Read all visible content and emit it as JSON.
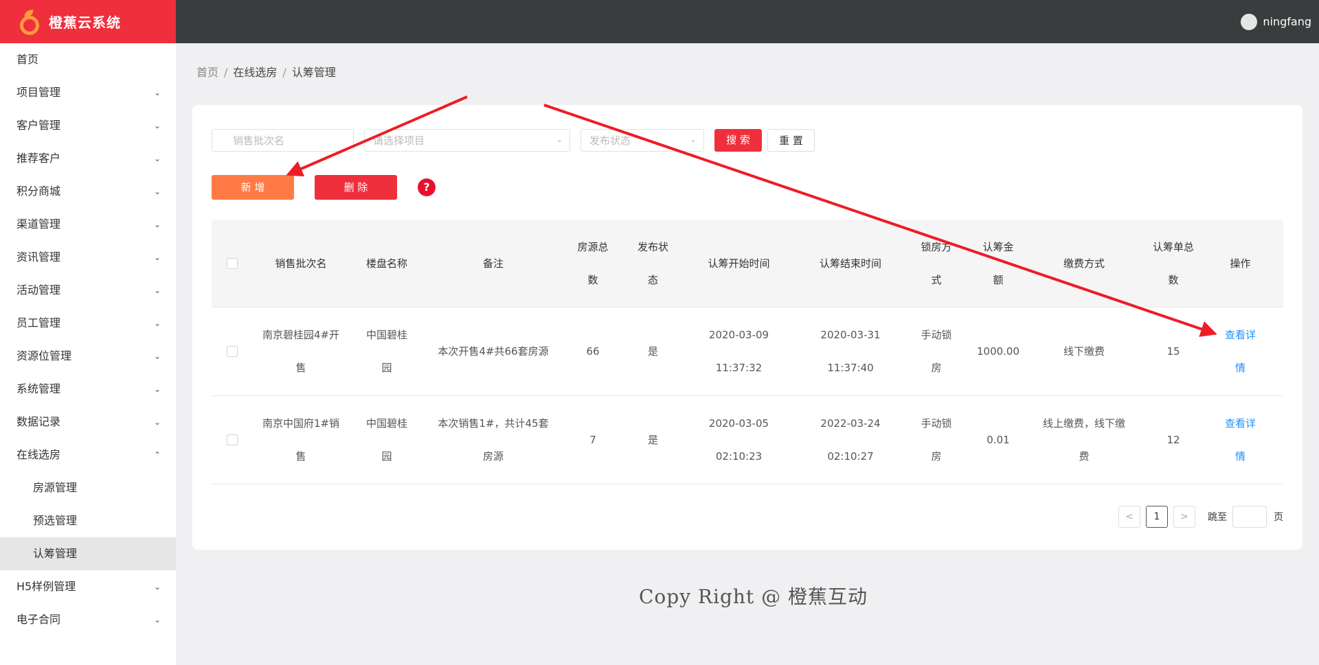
{
  "header": {
    "app_name": "橙蕉云系统",
    "username": "ningfang"
  },
  "sidebar": {
    "items": [
      {
        "label": "首页"
      },
      {
        "label": "项目管理"
      },
      {
        "label": "客户管理"
      },
      {
        "label": "推荐客户"
      },
      {
        "label": "积分商城"
      },
      {
        "label": "渠道管理"
      },
      {
        "label": "资讯管理"
      },
      {
        "label": "活动管理"
      },
      {
        "label": "员工管理"
      },
      {
        "label": "资源位管理"
      },
      {
        "label": "系统管理"
      },
      {
        "label": "数据记录"
      },
      {
        "label": "在线选房"
      },
      {
        "label": "H5样例管理"
      },
      {
        "label": "电子合同"
      }
    ],
    "sub_items": [
      {
        "label": "房源管理"
      },
      {
        "label": "预选管理"
      },
      {
        "label": "认筹管理"
      }
    ]
  },
  "breadcrumb": {
    "home": "首页",
    "parent": "在线选房",
    "current": "认筹管理",
    "sep": "/"
  },
  "filters": {
    "batch_placeholder": "销售批次名",
    "project_placeholder": "请选择项目",
    "status_placeholder": "发布状态",
    "search_label": "搜 索",
    "reset_label": "重 置"
  },
  "actions": {
    "add_label": "新 增",
    "delete_label": "删 除",
    "help": "?"
  },
  "table": {
    "headers": {
      "batch": "销售批次名",
      "building": "楼盘名称",
      "remark": "备注",
      "total_l1": "房源总",
      "total_l2": "数",
      "status_l1": "发布状",
      "status_l2": "态",
      "start": "认筹开始时间",
      "end": "认筹结束时间",
      "lock_l1": "锁房方",
      "lock_l2": "式",
      "amount_l1": "认筹金",
      "amount_l2": "额",
      "pay": "缴费方式",
      "orders_l1": "认筹单总",
      "orders_l2": "数",
      "op": "操作"
    },
    "rows": [
      {
        "batch_l1": "南京碧桂园4#开",
        "batch_l2": "售",
        "building_l1": "中国碧桂",
        "building_l2": "园",
        "remark_l1": "本次开售4#共66套房源",
        "remark_l2": "",
        "total": "66",
        "status": "是",
        "start_date": "2020-03-09",
        "start_time": "11:37:32",
        "end_date": "2020-03-31",
        "end_time": "11:37:40",
        "lock_l1": "手动锁",
        "lock_l2": "房",
        "amount": "1000.00",
        "pay_l1": "线下缴费",
        "pay_l2": "",
        "orders": "15",
        "op_l1": "查看详",
        "op_l2": "情"
      },
      {
        "batch_l1": "南京中国府1#销",
        "batch_l2": "售",
        "building_l1": "中国碧桂",
        "building_l2": "园",
        "remark_l1": "本次销售1#，共计45套",
        "remark_l2": "房源",
        "total": "7",
        "status": "是",
        "start_date": "2020-03-05",
        "start_time": "02:10:23",
        "end_date": "2022-03-24",
        "end_time": "02:10:27",
        "lock_l1": "手动锁",
        "lock_l2": "房",
        "amount": "0.01",
        "pay_l1": "线上缴费，线下缴",
        "pay_l2": "费",
        "orders": "12",
        "op_l1": "查看详",
        "op_l2": "情"
      }
    ]
  },
  "pagination": {
    "prev": "<",
    "current_page": "1",
    "next": ">",
    "goto_label": "跳至",
    "page_label": "页"
  },
  "footer": {
    "copyright": "Copy Right @ 橙蕉互动"
  },
  "colors": {
    "brand_red": "#ef2f3c",
    "header_dark": "#393d3e",
    "orange": "#ff7a45",
    "link": "#1e90ff",
    "annotation_arrow": "#ee1c25"
  }
}
